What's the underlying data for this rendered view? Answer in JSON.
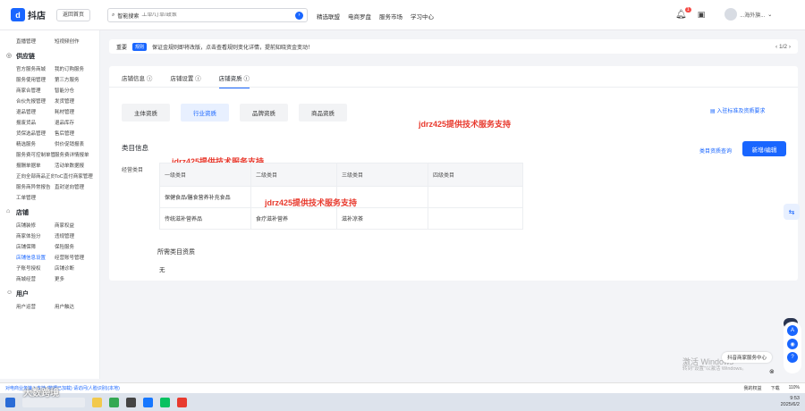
{
  "header": {
    "logo_text": "抖店",
    "back_home": "返回首页",
    "search_scope": "智能搜索",
    "search_placeholder": "工单/订单/政策",
    "nav": [
      "精选联盟",
      "电商罗盘",
      "服务市场",
      "学习中心"
    ],
    "notification_count": "1",
    "user_name": "...海外旗..."
  },
  "sidebar": {
    "top_items": [
      "直播管理",
      "短视频创作"
    ],
    "sections": [
      {
        "title": "供应链",
        "items": [
          "官方服务商城",
          "我的订购服务",
          "服务使用管理",
          "第三方服务",
          "商家合管理",
          "智能分仓",
          "合伙先报管理",
          "发货管理",
          "退品管理",
          "耗材管理",
          "报废货品",
          "退品库存",
          "货保选品管理",
          "售后管理",
          "精选服务",
          "供价促销报表",
          "服务费可控制单管理",
          "服务费详情报单",
          "报酬单据单",
          "活动单数据报",
          "正向全部商品正向订单查询",
          "ToC直付商家管理",
          "服务商异常报告",
          "直封逆向管理",
          "工单管理"
        ]
      },
      {
        "title": "店铺",
        "items": [
          "店铺装修",
          "商家权益",
          "商家体验分",
          "违规管理",
          "店铺保障",
          "保险服务",
          "店铺信息设置",
          "经营账号管理",
          "子账号授权",
          "店铺诊断",
          "商城经营",
          "更多"
        ]
      },
      {
        "title": "用户",
        "items": [
          "用户运营",
          "用户触达"
        ]
      }
    ],
    "active_item": "店铺信息设置"
  },
  "notice": {
    "tag": "重要",
    "badge": "规则",
    "text": "保证金规则即将改版，点击查看规则变化详情，提前知晓资金变动！",
    "pager": "1/2"
  },
  "main": {
    "tabs": [
      "店铺信息",
      "店铺设置",
      "店铺资质"
    ],
    "active_tab": "店铺资质",
    "subtabs": [
      "主体资质",
      "行业资质",
      "品牌资质",
      "商品资质"
    ],
    "active_subtab": "行业资质",
    "entry_link": "入驻标准及资质要求",
    "category_title": "类目信息",
    "category_query": "类目资质查询",
    "add_edit_button": "新增/编辑",
    "operating_label": "经营类目",
    "table_headers": [
      "一级类目",
      "二级类目",
      "三级类目",
      "四级类目"
    ],
    "table_rows": [
      [
        "保健食品/膳食营养补充食品",
        "",
        "",
        ""
      ],
      [
        "传统滋补营养品",
        "食疗滋补营养",
        "滋补凉茶",
        ""
      ]
    ],
    "required_title": "所需类目资质",
    "required_value": "无",
    "watermark": "jdrz425提供技术服务支持"
  },
  "floating": {
    "service_center": "抖音商家服务中心",
    "activate_windows": "激活 Windows",
    "activate_sub": "转到\"设置\"以激活 Windows。"
  },
  "statusbar": {
    "left": "对电商业务接入支持 (数据已加载) 请访问(人脸识别)(本地)",
    "items": [
      "我的权益",
      "下载",
      "110%"
    ]
  },
  "taskbar": {
    "brand_watermark": "大数跨境",
    "time": "9:53",
    "date": "2025/6/2"
  },
  "colors": {
    "accent": "#1966ff",
    "watermark": "#e83a2e"
  }
}
